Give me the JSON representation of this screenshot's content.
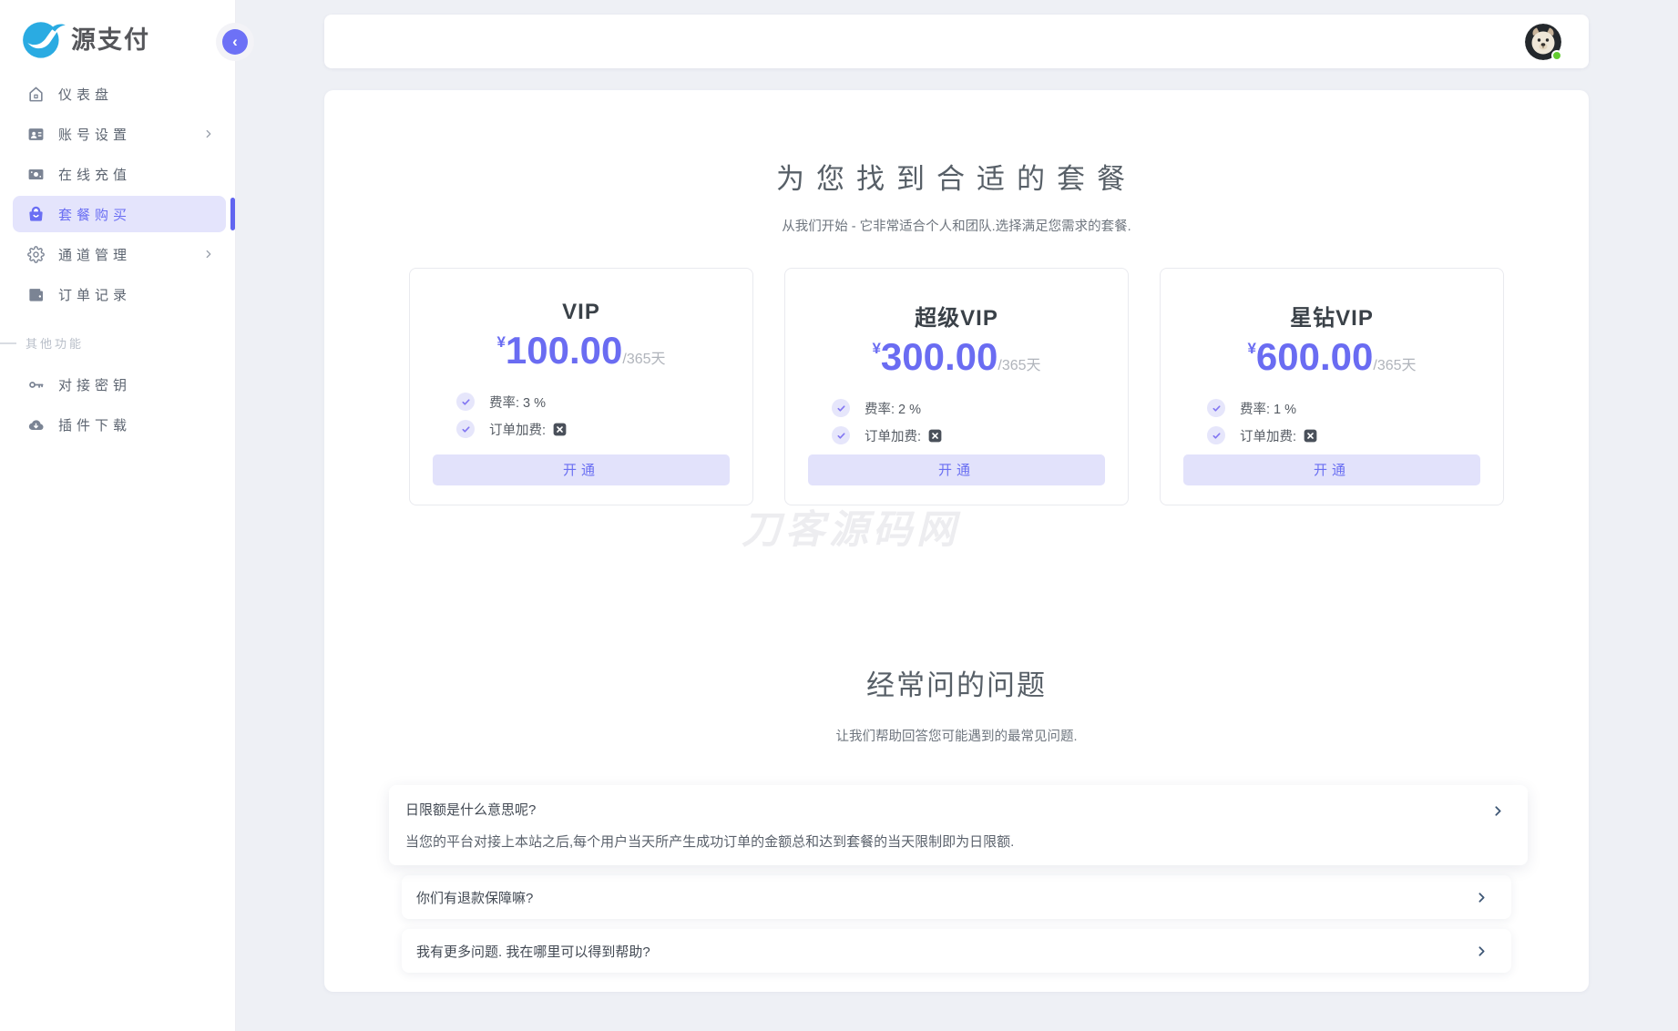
{
  "brand": {
    "name": "源支付"
  },
  "sidebar": {
    "menu": [
      {
        "label": "仪表盘"
      },
      {
        "label": "账号设置"
      },
      {
        "label": "在线充值"
      },
      {
        "label": "套餐购买"
      },
      {
        "label": "通道管理"
      },
      {
        "label": "订单记录"
      }
    ],
    "section_label": "其他功能",
    "extra": [
      {
        "label": "对接密钥"
      },
      {
        "label": "插件下载"
      }
    ],
    "collapse_glyph": "‹"
  },
  "pricing": {
    "title": "为您找到合适的套餐",
    "subtitle": "从我们开始 - 它非常适合个人和团队.选择满足您需求的套餐.",
    "plans": [
      {
        "name": "VIP",
        "currency": "¥",
        "price": "100.00",
        "period": "/365天",
        "features": [
          {
            "label": "费率: 3 %"
          },
          {
            "label": "订单加费:"
          }
        ],
        "action": "开通"
      },
      {
        "name": "超级VIP",
        "currency": "¥",
        "price": "300.00",
        "period": "/365天",
        "features": [
          {
            "label": "费率: 2 %"
          },
          {
            "label": "订单加费:"
          }
        ],
        "action": "开通"
      },
      {
        "name": "星钻VIP",
        "currency": "¥",
        "price": "600.00",
        "period": "/365天",
        "features": [
          {
            "label": "费率: 1 %"
          },
          {
            "label": "订单加费:"
          }
        ],
        "action": "开通"
      }
    ]
  },
  "watermark": "刀客源码网",
  "faq": {
    "title": "经常问的问题",
    "subtitle": "让我们帮助回答您可能遇到的最常见问题.",
    "items": [
      {
        "question": "日限额是什么意思呢?",
        "answer": "当您的平台对接上本站之后,每个用户当天所产生成功订单的金额总和达到套餐的当天限制即为日限额.",
        "expanded": true
      },
      {
        "question": "你们有退款保障嘛?",
        "expanded": false
      },
      {
        "question": "我有更多问题. 我在哪里可以得到帮助?",
        "expanded": false
      }
    ]
  },
  "colors": {
    "accent": "#6a6ef3",
    "accent_light": "#e4e4fc",
    "brand_blue": "#2aabe2",
    "status_green": "#63cc30",
    "price_purple": "#6a6cf2"
  },
  "header": {
    "avatar_status": "online"
  }
}
